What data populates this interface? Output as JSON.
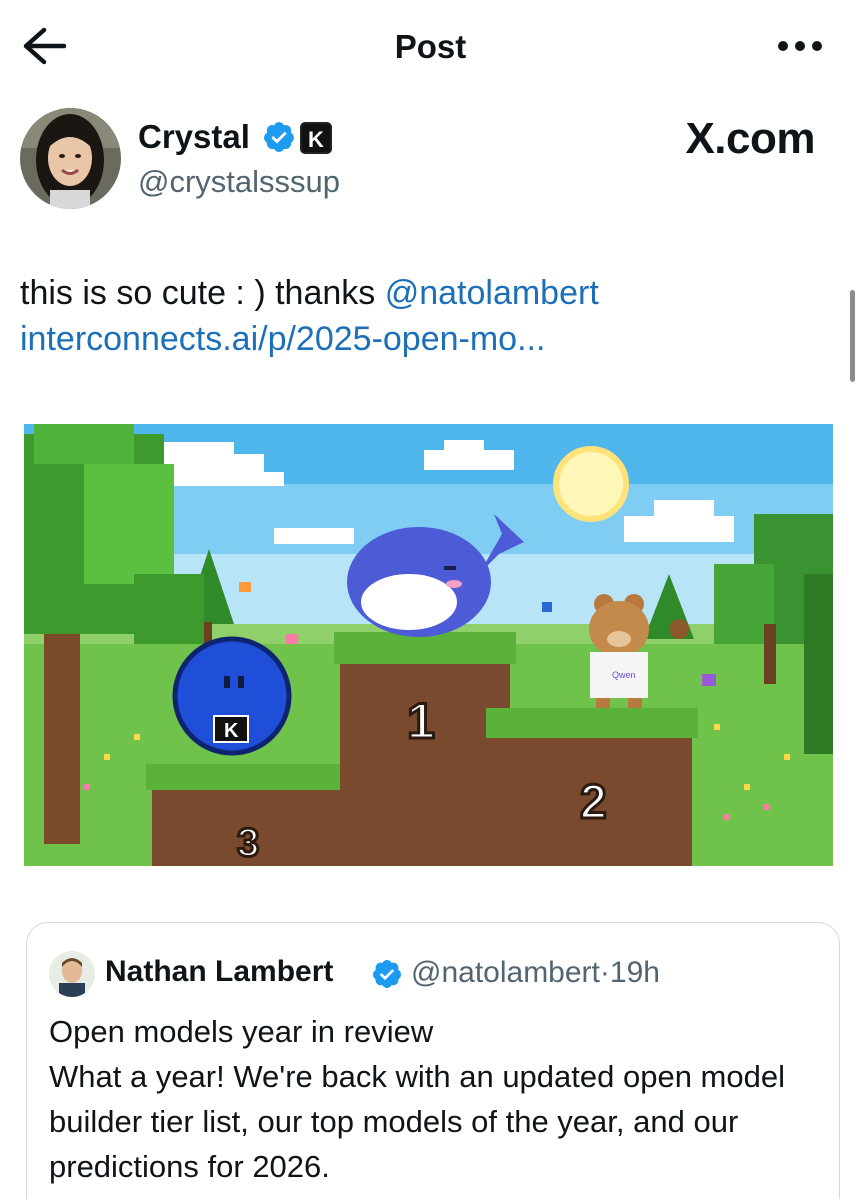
{
  "header": {
    "title": "Post",
    "back_icon": "arrow-left-icon",
    "more_icon": "more-horizontal-icon"
  },
  "post": {
    "author_name": "Crystal",
    "author_handle": "@crystalsssup",
    "verified_icon": "verified-badge-icon",
    "affiliate_badge": "K",
    "source_label": "X.com",
    "text_before_mention": "this is so cute : ) thanks ",
    "mention": "@natolambert",
    "link": "interconnects.ai/p/2025-open-mo...",
    "image": {
      "podium_labels": [
        "1",
        "2",
        "3"
      ],
      "shirt_text": "Qwen",
      "ball_badge": "K"
    }
  },
  "quote": {
    "author_name": "Nathan Lambert",
    "author_handle": "@natolambert",
    "separator": "·",
    "time": "19h",
    "title": "Open models year in review",
    "body": "What a year! We're back with an updated open model builder tier list, our top models of the year, and our predictions for 2026."
  },
  "colors": {
    "link": "#1d70b8",
    "verified": "#1d9bf0",
    "secondary_text": "#536471"
  }
}
